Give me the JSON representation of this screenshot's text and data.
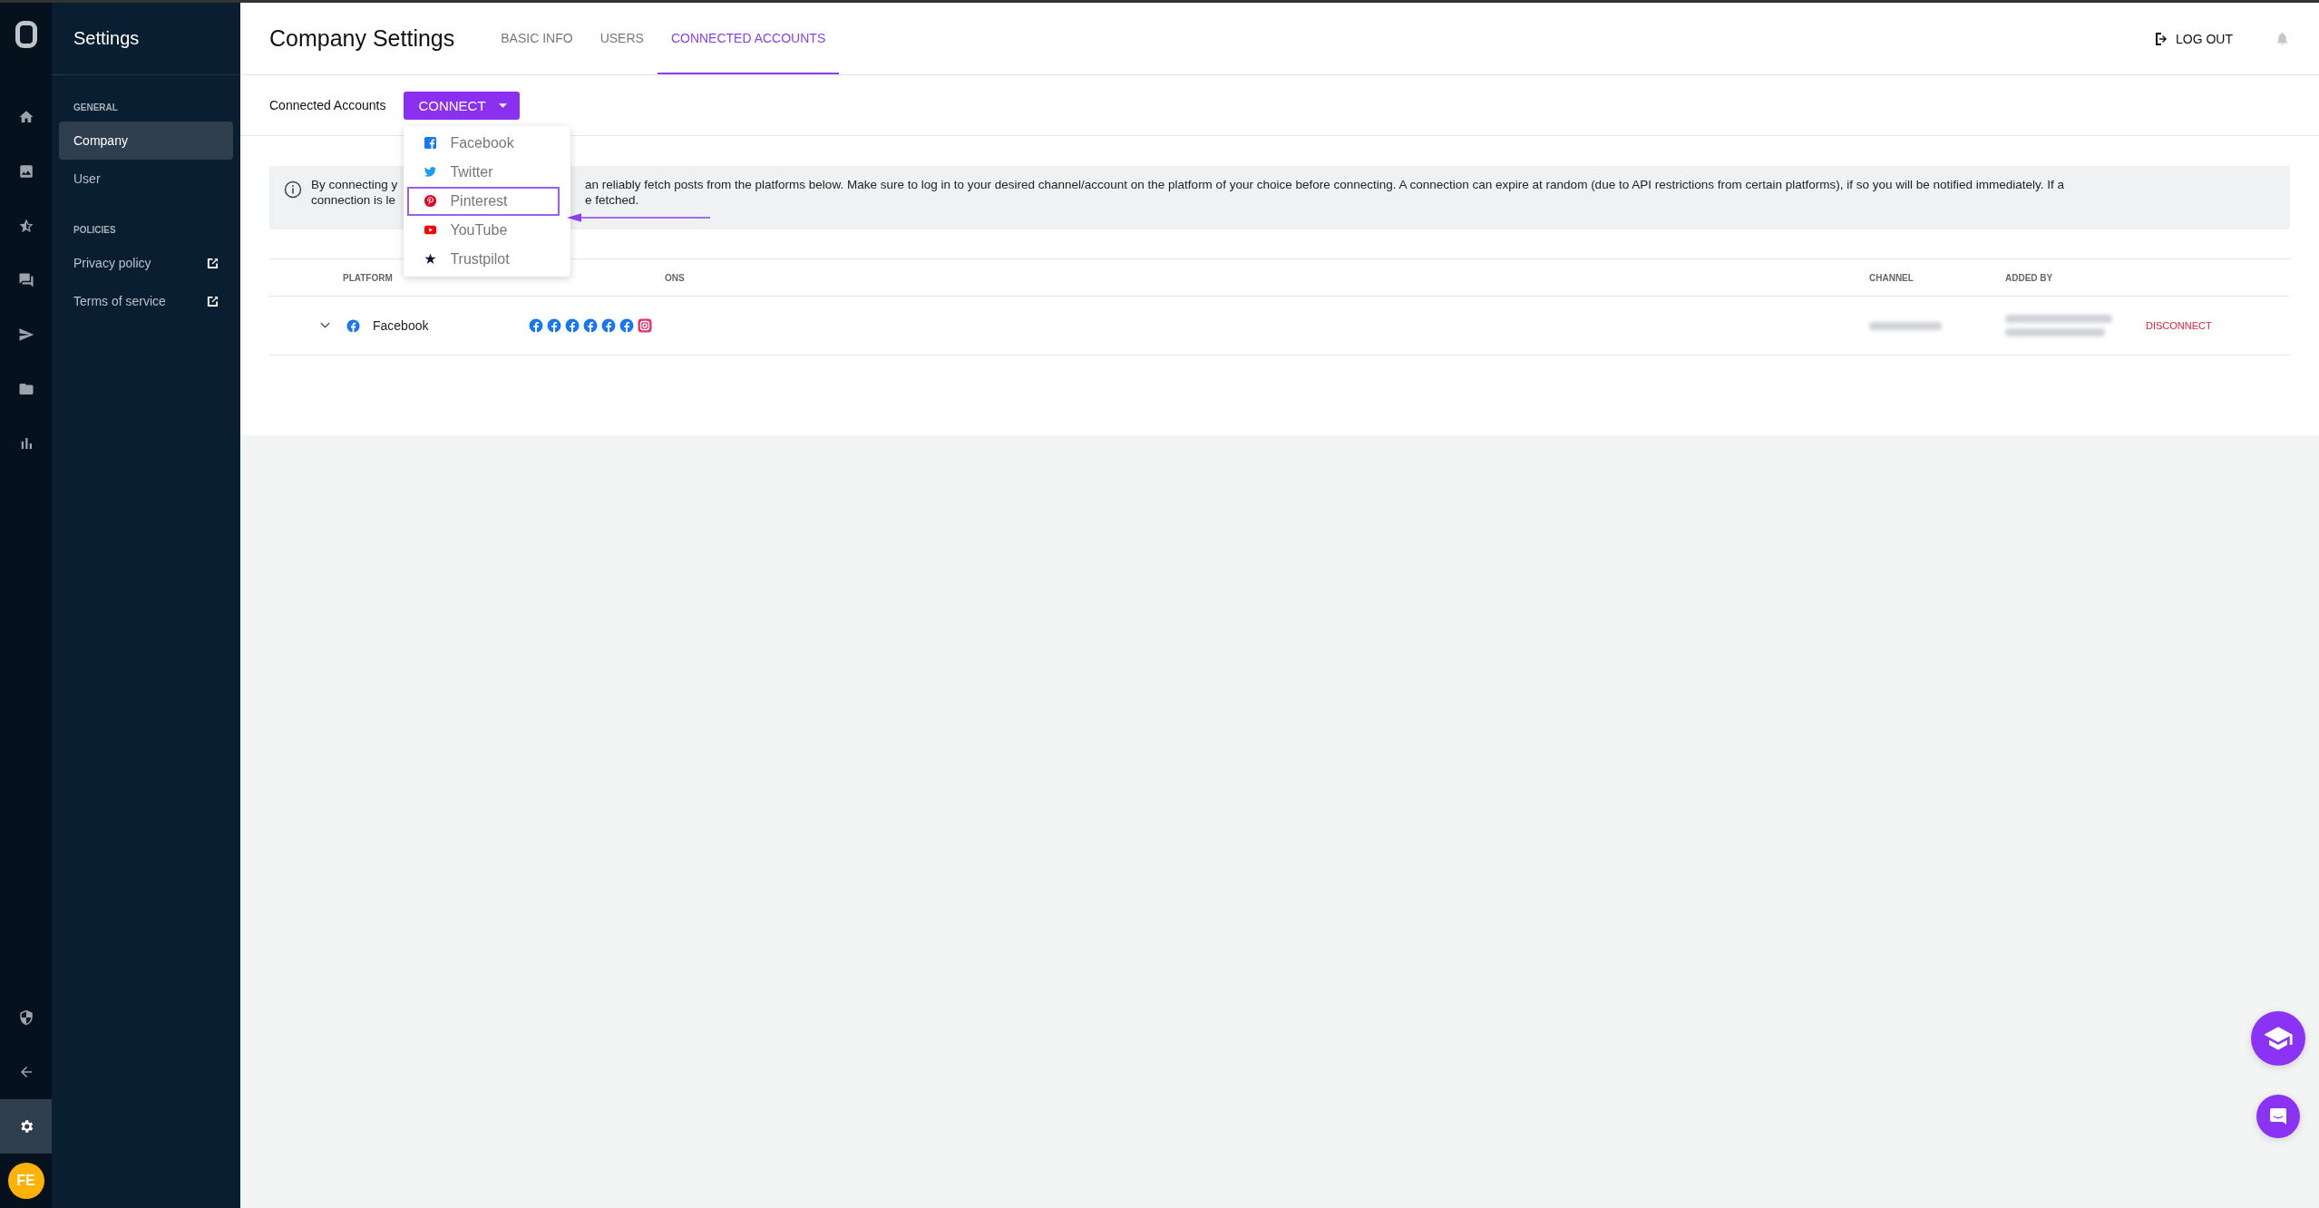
{
  "rail": [
    {
      "kind": "home",
      "selected": false
    },
    {
      "kind": "image",
      "selected": false
    },
    {
      "kind": "star",
      "selected": false
    },
    {
      "kind": "chat",
      "selected": false
    },
    {
      "kind": "send",
      "selected": false
    },
    {
      "kind": "folder",
      "selected": false
    },
    {
      "kind": "chart",
      "selected": false
    }
  ],
  "rail_bottom": [
    {
      "kind": "shield",
      "selected": false
    },
    {
      "kind": "back",
      "selected": false
    },
    {
      "kind": "gear",
      "selected": true
    }
  ],
  "avatar": {
    "initials": "FE"
  },
  "sidebar": {
    "title": "Settings",
    "sections": [
      {
        "heading": "GENERAL",
        "items": [
          {
            "label": "Company",
            "selected": true,
            "external": false
          },
          {
            "label": "User",
            "selected": false,
            "external": false
          }
        ]
      },
      {
        "heading": "POLICIES",
        "items": [
          {
            "label": "Privacy policy",
            "selected": false,
            "external": true
          },
          {
            "label": "Terms of service",
            "selected": false,
            "external": true
          }
        ]
      }
    ]
  },
  "header": {
    "title": "Company Settings",
    "tabs": [
      {
        "label": "BASIC INFO",
        "selected": false
      },
      {
        "label": "USERS",
        "selected": false
      },
      {
        "label": "CONNECTED ACCOUNTS",
        "selected": true
      }
    ],
    "logout": "LOG OUT"
  },
  "toolbar": {
    "label": "Connected Accounts",
    "connect_button": "CONNECT"
  },
  "dropdown": [
    {
      "kind": "facebook",
      "label": "Facebook",
      "highlighted": false
    },
    {
      "kind": "twitter",
      "label": "Twitter",
      "highlighted": false
    },
    {
      "kind": "pinterest",
      "label": "Pinterest",
      "highlighted": true
    },
    {
      "kind": "youtube",
      "label": "YouTube",
      "highlighted": false
    },
    {
      "kind": "trustpilot",
      "label": "Trustpilot",
      "highlighted": false
    }
  ],
  "info": {
    "lines": [
      {
        "left": "By connecting y",
        "right": "an reliably fetch posts from the platforms below. Make sure to log in to your desired channel/account on the platform of your choice before connecting. A connection can expire at random (due to API restrictions from certain platforms), if so you will be notified immediately. If a"
      },
      {
        "left": "connection is le",
        "right": "e fetched."
      }
    ]
  },
  "table": {
    "columns": [
      "PLATFORM",
      "ONS",
      "CHANNEL",
      "ADDED BY"
    ],
    "rows": [
      {
        "expanded": false,
        "platform": {
          "kind": "facebook",
          "label": "Facebook"
        },
        "connections": [
          {
            "kind": "facebook"
          },
          {
            "kind": "facebook"
          },
          {
            "kind": "facebook"
          },
          {
            "kind": "facebook"
          },
          {
            "kind": "facebook"
          },
          {
            "kind": "facebook"
          },
          {
            "kind": "instagram"
          }
        ],
        "action": "DISCONNECT"
      }
    ]
  }
}
